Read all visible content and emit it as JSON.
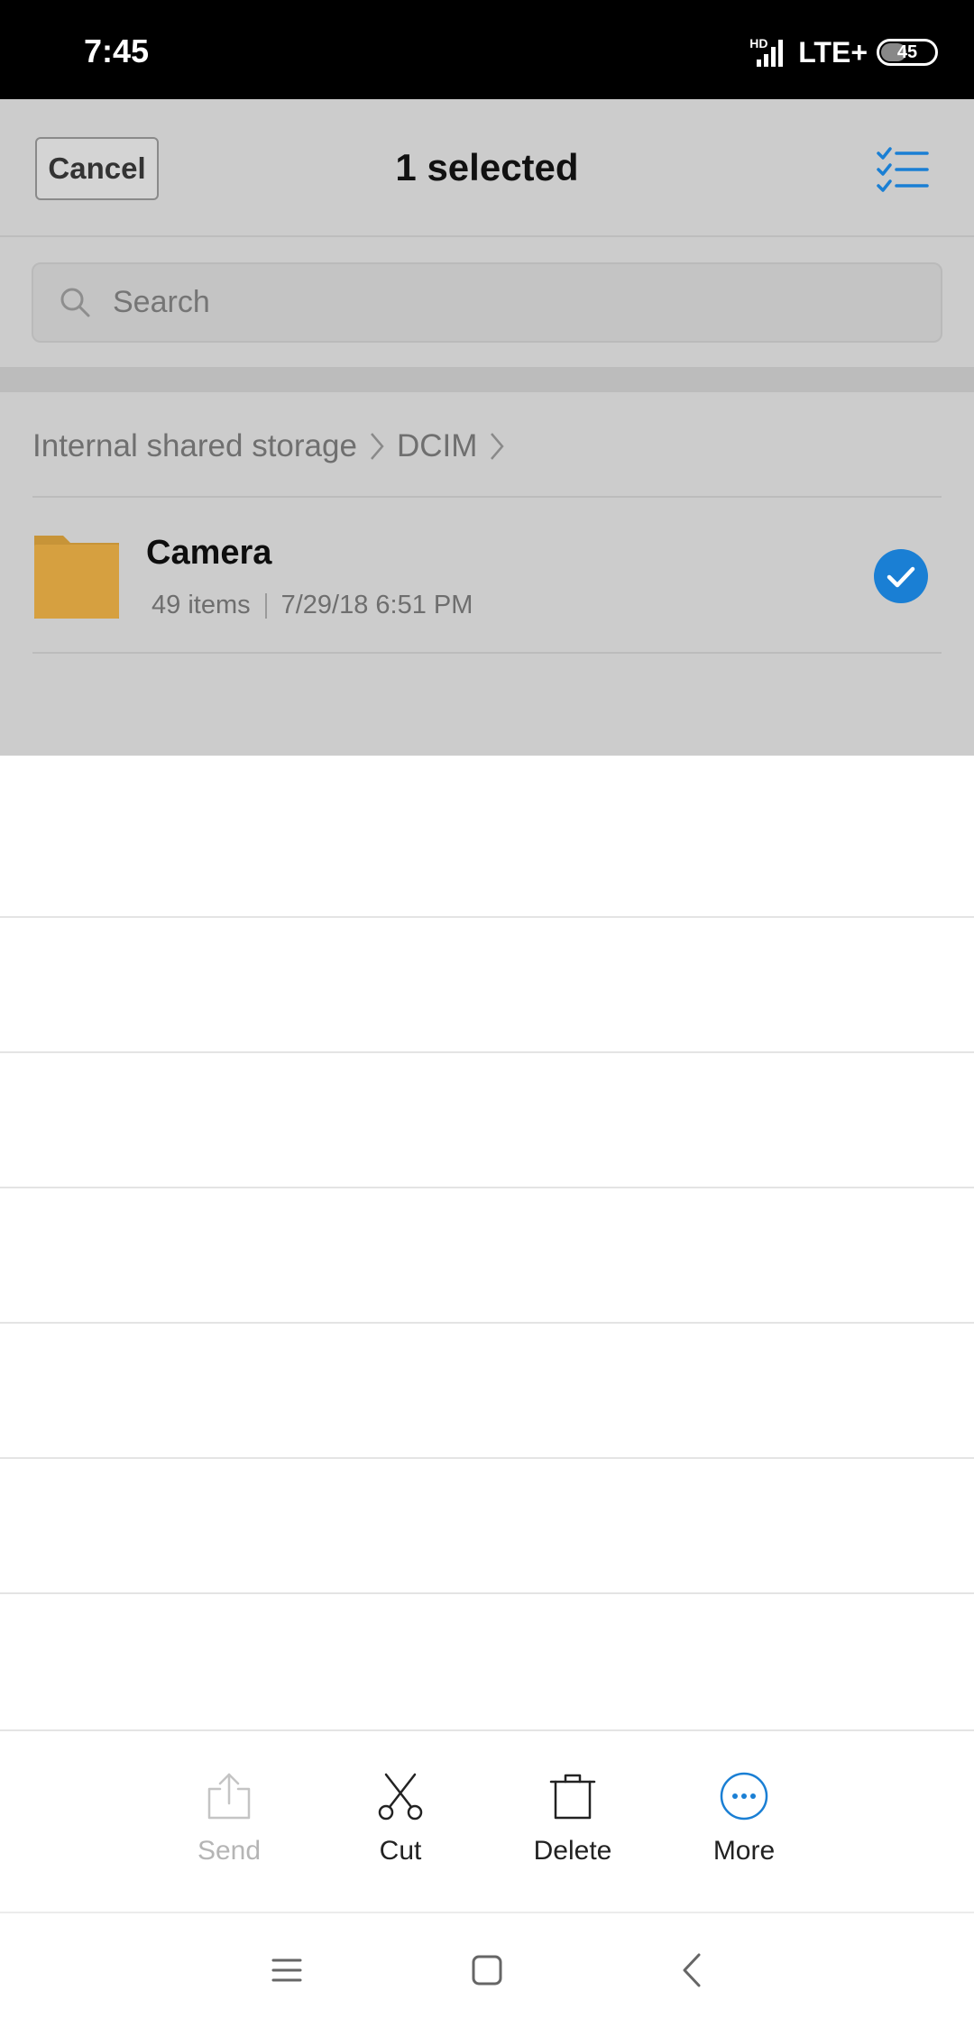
{
  "status_bar": {
    "time": "7:45",
    "hd_label": "HD",
    "network": "LTE+",
    "battery": "45"
  },
  "header": {
    "cancel_label": "Cancel",
    "title": "1 selected",
    "select_all_icon": "checklist-icon"
  },
  "search": {
    "placeholder": "Search"
  },
  "breadcrumb": {
    "items": [
      "Internal shared storage",
      "DCIM"
    ]
  },
  "folders": [
    {
      "name": "Camera",
      "item_count": "49 items",
      "modified": "7/29/18 6:51 PM",
      "selected": true
    }
  ],
  "actions": [
    {
      "label": "Send",
      "icon": "share-icon",
      "enabled": false
    },
    {
      "label": "Cut",
      "icon": "scissors-icon",
      "enabled": true
    },
    {
      "label": "Delete",
      "icon": "trash-icon",
      "enabled": true
    },
    {
      "label": "More",
      "icon": "more-icon",
      "enabled": true
    }
  ],
  "nav_bar": {
    "icons": [
      "menu-icon",
      "home-icon",
      "back-icon"
    ]
  },
  "colors": {
    "accent": "#1a7fd4",
    "folder": "#d6a040",
    "dim_overlay": "#cccccc"
  }
}
